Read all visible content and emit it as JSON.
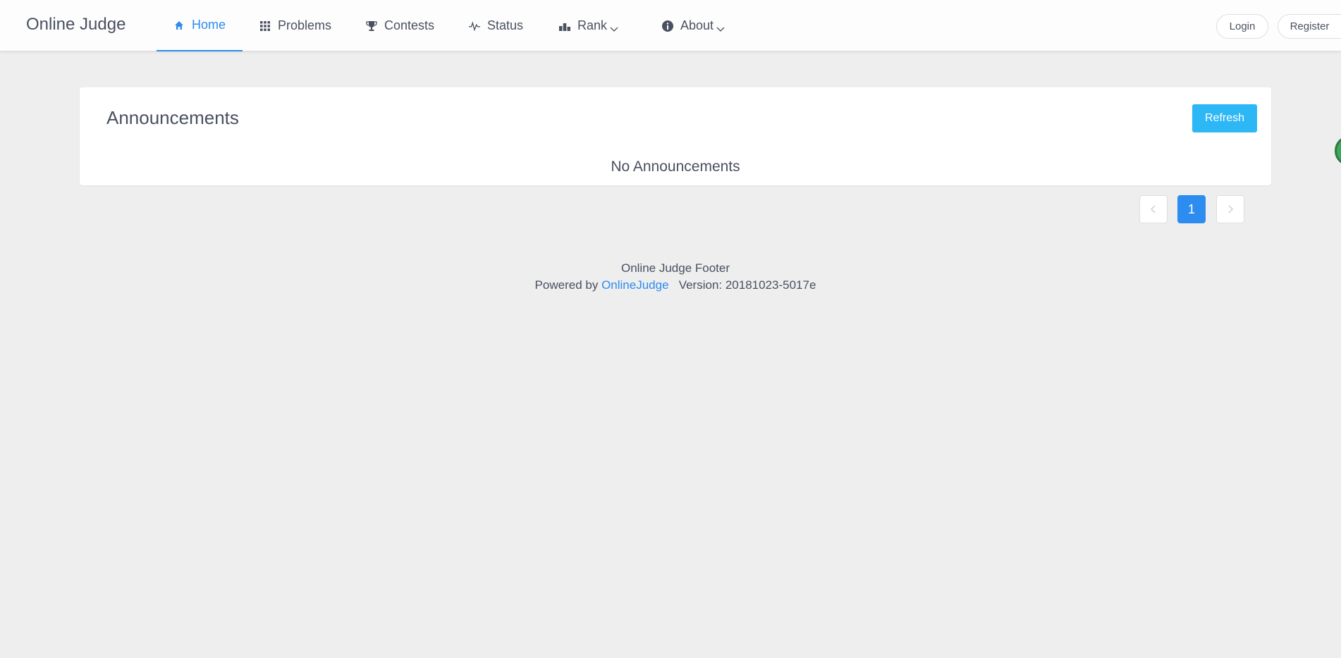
{
  "header": {
    "logo": "Online Judge",
    "nav": [
      {
        "label": "Home",
        "icon": "home-icon",
        "active": true
      },
      {
        "label": "Problems",
        "icon": "grid-icon"
      },
      {
        "label": "Contests",
        "icon": "trophy-icon"
      },
      {
        "label": "Status",
        "icon": "pulse-icon"
      },
      {
        "label": "Rank",
        "icon": "bar-chart-icon",
        "dropdown": true
      },
      {
        "label": "About",
        "icon": "info-icon",
        "dropdown": true
      }
    ],
    "login_label": "Login",
    "register_label": "Register"
  },
  "announcements": {
    "title": "Announcements",
    "refresh_label": "Refresh",
    "empty_text": "No Announcements"
  },
  "pagination": {
    "current_page": "1"
  },
  "footer": {
    "line1": "Online Judge Footer",
    "powered_by": "Powered by",
    "link_text": "OnlineJudge",
    "version": "Version: 20181023-5017e"
  },
  "colors": {
    "accent": "#2d8cf0",
    "refresh_button": "#2db7f5",
    "background": "#eeeeee"
  }
}
